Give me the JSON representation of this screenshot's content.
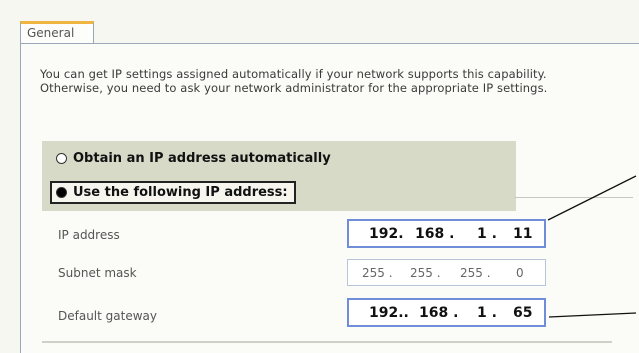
{
  "tab": {
    "label": "General"
  },
  "description": "You can get IP settings assigned automatically if your network supports this capability. Otherwise, you need to ask your network administrator for the appropriate IP settings.",
  "radios": {
    "auto": {
      "label": "Obtain an IP address automatically",
      "checked": false
    },
    "manual": {
      "label": "Use the following IP address:",
      "checked": true
    }
  },
  "fields": [
    {
      "label": "IP address",
      "octets": [
        "192.",
        "168 .",
        "1 .",
        "11"
      ]
    },
    {
      "label": "Subnet mask",
      "octets": [
        "255 .",
        "255 .",
        "255 .",
        "0"
      ]
    },
    {
      "label": "Default gateway",
      "octets": [
        "192..",
        "168 .",
        "1 .",
        "65"
      ]
    }
  ],
  "colors": {
    "accent_tab": "#f0b540",
    "highlight_border": "#6f8dd8",
    "group_bg": "#d8dac8"
  }
}
